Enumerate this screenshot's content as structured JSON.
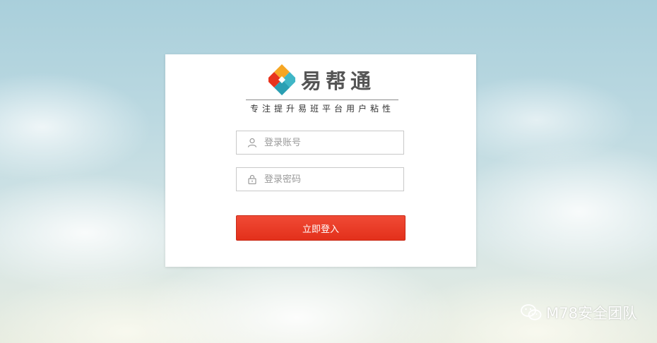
{
  "brand": {
    "name": "易帮通",
    "slogan": "专注提升易班平台用户粘性"
  },
  "login": {
    "account_placeholder": "登录账号",
    "password_placeholder": "登录密码",
    "submit_label": "立即登入"
  },
  "watermark": {
    "text": "M78安全团队"
  },
  "icons": {
    "account": "user-icon",
    "password": "lock-icon",
    "watermark": "wechat-icon"
  },
  "colors": {
    "button": "#e8331d",
    "card": "#ffffff"
  }
}
